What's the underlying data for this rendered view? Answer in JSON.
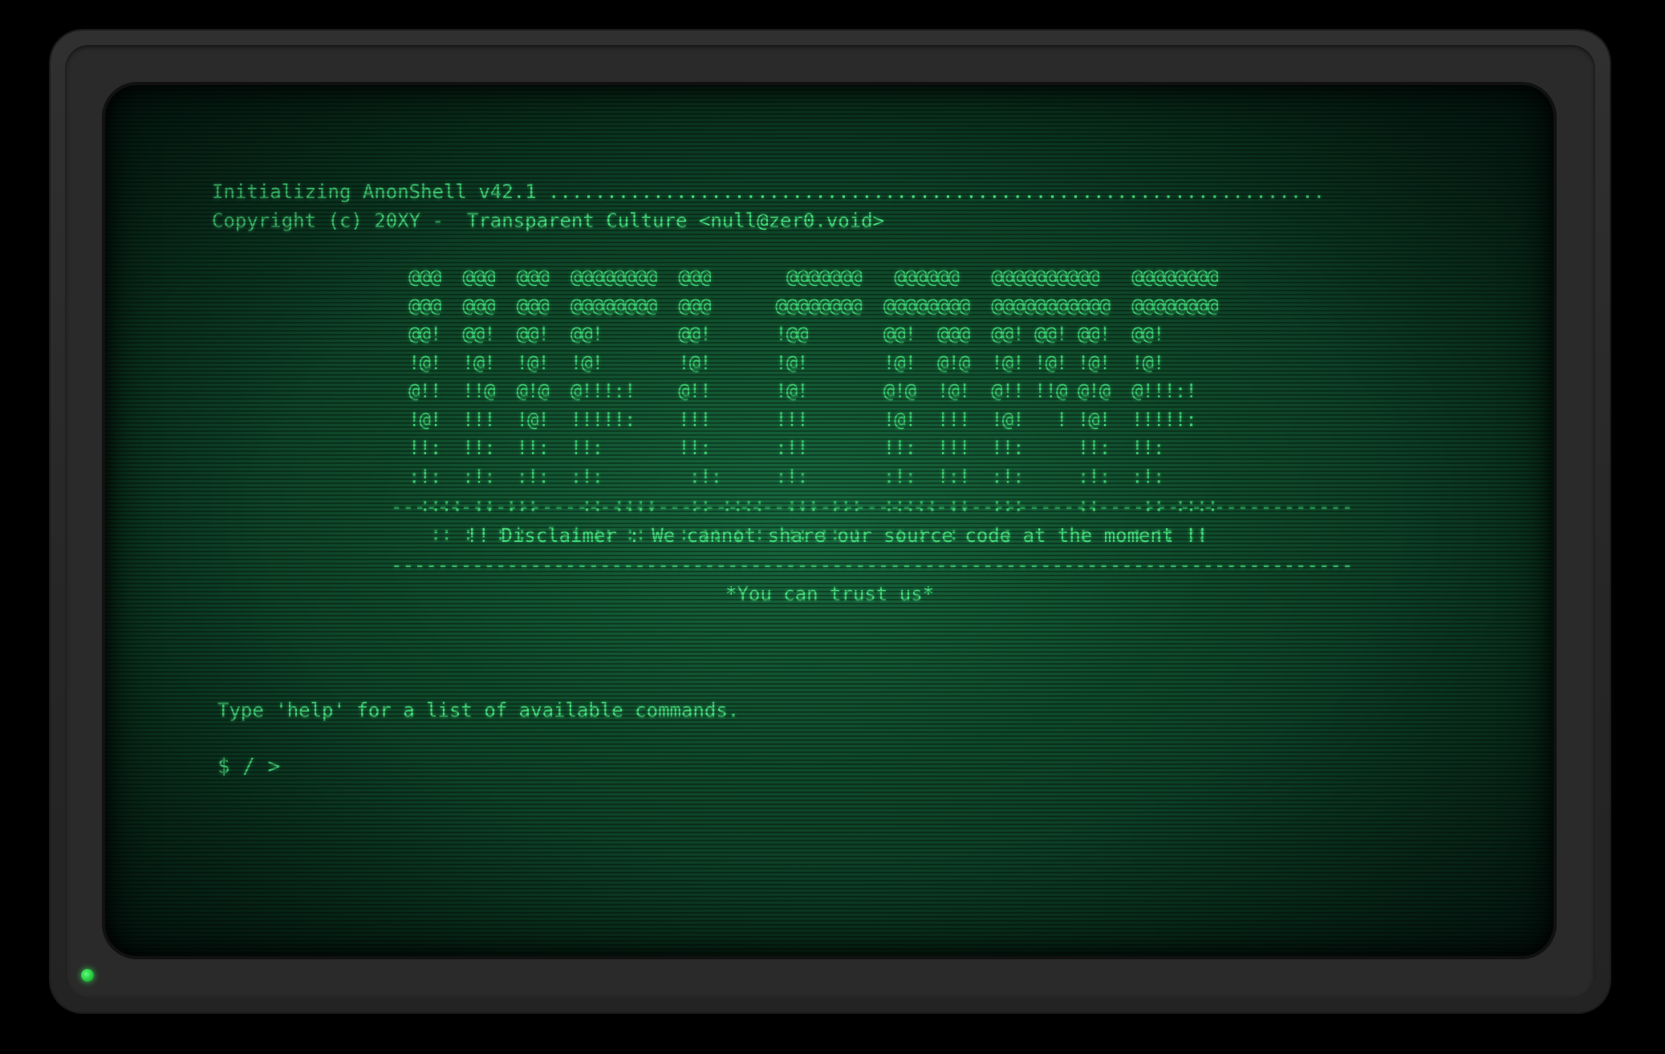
{
  "terminal": {
    "init_line": "Initializing AnonShell v42.1 ...................................................................",
    "copyright_line": "Copyright (c) 20XY -  Transparent Culture <null@zer0.void>",
    "banner_art": "@@@  @@@  @@@  @@@@@@@@  @@@       @@@@@@@   @@@@@@   @@@@@@@@@@   @@@@@@@@\n@@@  @@@  @@@  @@@@@@@@  @@@      @@@@@@@@  @@@@@@@@  @@@@@@@@@@@  @@@@@@@@\n@@!  @@!  @@!  @@!       @@!      !@@       @@!  @@@  @@! @@! @@!  @@!\n!@!  !@!  !@!  !@!       !@!      !@!       !@!  @!@  !@! !@! !@!  !@!\n@!!  !!@  @!@  @!!!:!    @!!      !@!       @!@  !@!  @!! !!@ @!@  @!!!:!\n!@!  !!!  !@!  !!!!!:    !!!      !!!       !@!  !!!  !@!   ! !@!  !!!!!:\n!!:  !!:  !!:  !!:       !!:      :!!       !!:  !!!  !!:     !!:  !!:\n:!:  :!:  :!:  :!:        :!:     :!:       :!:  !:!  :!:     :!:  :!:\n :::: :: :::    :: ::::   :: ::::  ::: :::  ::::: ::  :::     ::    :: ::::\n  :: :  : :    : :: ::   : :: : :  :: :: :   : :  :    :      :    : :: ::",
    "rule": "-----------------------------------------------------------------------------------",
    "disclaimer": "!! Disclaimer : We cannot share our source code at the moment !!",
    "trust": "*You can trust us*",
    "help_hint": "Type 'help' for a list of available commands.",
    "prompt": "$ / >"
  },
  "colors": {
    "phosphor": "#46e07e",
    "screen_center": "#17683e",
    "screen_edge": "#06241a",
    "bezel": "#2a2a2a",
    "power_led": "#23c23c"
  },
  "icons": {
    "power_led": "power-led-icon"
  }
}
